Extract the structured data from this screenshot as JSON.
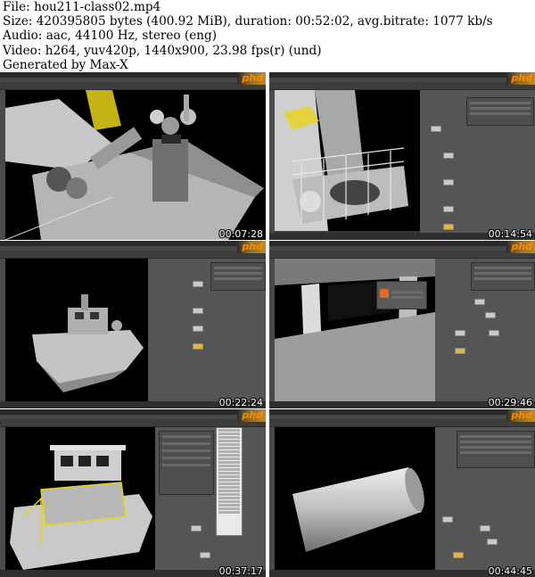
{
  "header": {
    "file_line": "File: hou211-class02.mp4",
    "size_line": "Size: 420395805 bytes (400.92 MiB), duration: 00:52:02, avg.bitrate: 1077 kb/s",
    "audio_line": "Audio: aac, 44100 Hz, stereo (eng)",
    "video_line": "Video: h264, yuv420p, 1440x900, 23.98 fps(r) (und)",
    "generator_line": "Generated by Max-X"
  },
  "logo_text": "phd",
  "thumbnails": [
    {
      "timestamp": "00:07:28",
      "subject": "boat-crane-closeup"
    },
    {
      "timestamp": "00:14:54",
      "subject": "boat-deck-railing"
    },
    {
      "timestamp": "00:22:24",
      "subject": "boat-side-view"
    },
    {
      "timestamp": "00:29:46",
      "subject": "cabin-interior"
    },
    {
      "timestamp": "00:37:17",
      "subject": "boat-cabin-selected"
    },
    {
      "timestamp": "00:44:45",
      "subject": "tube-geometry"
    }
  ],
  "colors": {
    "ui_dark": "#393939",
    "viewport": "#000000",
    "network_bg": "#555555",
    "selection_yellow": "#e8d21a",
    "node_selected": "#e3b24a",
    "logo_orange": "#ff8a00"
  }
}
